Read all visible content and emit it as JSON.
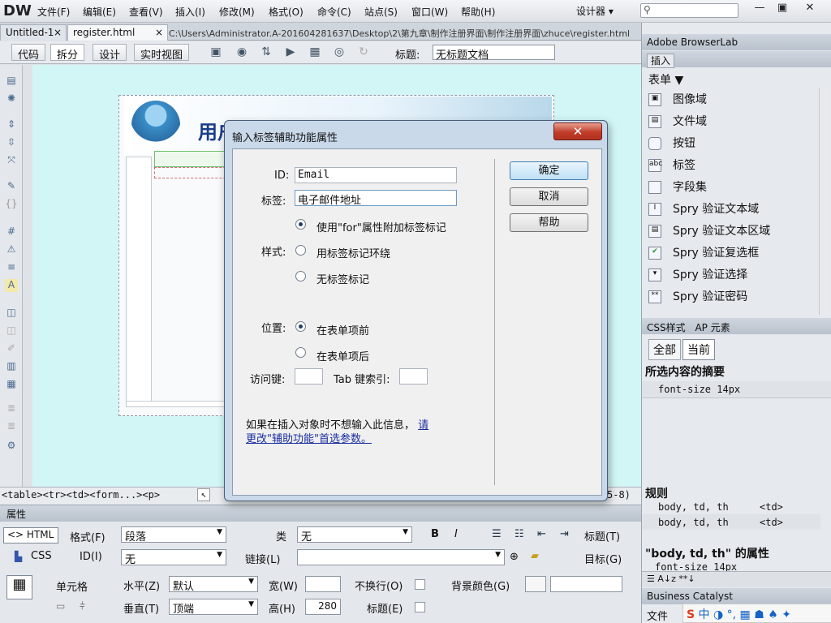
{
  "app": {
    "logo": "DW",
    "workspace": "设计器 ▾",
    "win_min": "—",
    "win_max": "▣",
    "win_close": "✕"
  },
  "menu": [
    "文件(F)",
    "编辑(E)",
    "查看(V)",
    "插入(I)",
    "修改(M)",
    "格式(O)",
    "命令(C)",
    "站点(S)",
    "窗口(W)",
    "帮助(H)"
  ],
  "tabs": [
    {
      "label": "Untitled-1",
      "close": "×"
    },
    {
      "label": "register.html",
      "close": "×"
    }
  ],
  "path": "C:\\Users\\Administrator.A-201604281637\\Desktop\\2\\第九章\\制作注册界面\\制作注册界面\\zhuce\\register.html",
  "toolbar": {
    "views": [
      "代码",
      "拆分",
      "设计",
      "实时视图"
    ],
    "title_label": "标题:",
    "title_value": "无标题文档"
  },
  "canvas": {
    "banner_title": "用户注册"
  },
  "statusbar": {
    "tags": "<table><tr><td><form...><p>",
    "right": "5-8)"
  },
  "props": {
    "header": "属性",
    "html_btn": "<> HTML",
    "css_btn": "CSS",
    "format_label": "格式(F)",
    "format_value": "段落",
    "class_label": "类",
    "class_value": "无",
    "bold": "B",
    "italic": "I",
    "title_label": "标题(T)",
    "id_label": "ID(I)",
    "id_value": "无",
    "link_label": "链接(L)",
    "target_label": "目标(G)",
    "cell_label": "单元格",
    "horz_label": "水平(Z)",
    "horz_value": "默认",
    "width_label": "宽(W)",
    "width_value": "",
    "nowrap_label": "不换行(O)",
    "bg_label": "背景颜色(G)",
    "vert_label": "垂直(T)",
    "vert_value": "顶端",
    "height_label": "高(H)",
    "height_value": "280",
    "header_label": "标题(E)"
  },
  "right": {
    "browserlab": "Adobe BrowserLab",
    "insert_tab": "插入",
    "category": "表单 ▼",
    "items": [
      {
        "label": "图像域",
        "icon": "image-field-icon"
      },
      {
        "label": "文件域",
        "icon": "file-field-icon"
      },
      {
        "label": "按钮",
        "icon": "button-icon"
      },
      {
        "label": "标签",
        "icon": "label-icon"
      },
      {
        "label": "字段集",
        "icon": "fieldset-icon"
      },
      {
        "label": "Spry 验证文本域",
        "icon": "spry-text-icon"
      },
      {
        "label": "Spry 验证文本区域",
        "icon": "spry-textarea-icon"
      },
      {
        "label": "Spry 验证复选框",
        "icon": "spry-checkbox-icon"
      },
      {
        "label": "Spry 验证选择",
        "icon": "spry-select-icon"
      },
      {
        "label": "Spry 验证密码",
        "icon": "spry-password-icon"
      }
    ],
    "css_tabs": [
      "CSS样式",
      "AP 元素"
    ],
    "css_modes": [
      "全部",
      "当前"
    ],
    "summary_title": "所选内容的摘要",
    "summary_row": "font-size  14px",
    "rules_title": "规则",
    "rules": [
      [
        "body, td, th",
        "<td>"
      ],
      [
        "body, td, th",
        "<td>"
      ]
    ],
    "props_title": "\"body, td, th\" 的属性",
    "props_row": "font-size  14px",
    "bc": "Business Catalyst",
    "files": "文件"
  },
  "dialog": {
    "title": "输入标签辅助功能属性",
    "close": "✕",
    "id_label": "ID:",
    "id_value": "Email",
    "label_label": "标签:",
    "label_value": "电子邮件地址",
    "style_label": "样式:",
    "style_options": [
      "使用\"for\"属性附加标签标记",
      "用标签标记环绕",
      "无标签标记"
    ],
    "pos_label": "位置:",
    "pos_options": [
      "在表单项前",
      "在表单项后"
    ],
    "access_label": "访问键:",
    "tab_label": "Tab 键索引:",
    "note": "如果在插入对象时不想输入此信息，",
    "note_link1": "请",
    "note_link2": "更改\"辅助功能\"首选参数。",
    "ok": "确定",
    "cancel": "取消",
    "help": "帮助"
  }
}
